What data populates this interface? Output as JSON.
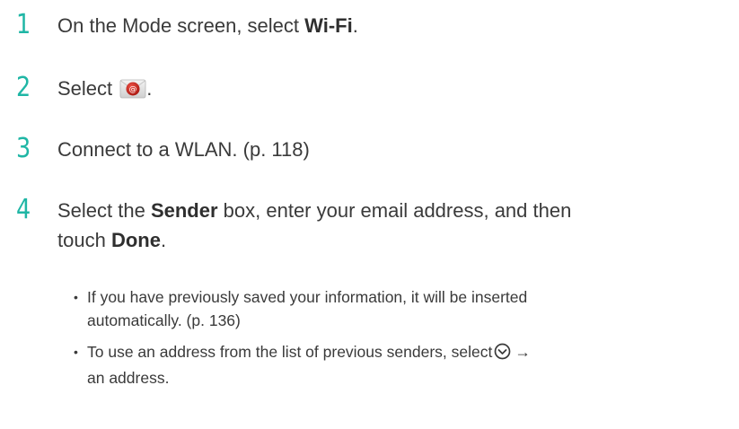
{
  "steps": [
    {
      "num": "1",
      "pre": "On the Mode screen, select ",
      "bold": "Wi-Fi",
      "post": "."
    },
    {
      "num": "2",
      "pre": "Select ",
      "icon": "email-app-icon",
      "post": "."
    },
    {
      "num": "3",
      "text": "Connect to a WLAN. (p. 118)"
    },
    {
      "num": "4",
      "pre": "Select the ",
      "bold1": "Sender",
      "mid": " box, enter your email address, and then",
      "line2_pre": "touch ",
      "bold2": "Done",
      "post": "."
    }
  ],
  "bullets": [
    {
      "line1": "If you have previously saved your information, it will be inserted",
      "line2": "automatically. (p. 136)"
    },
    {
      "line1_pre": "To use an address from the list of previous senders, select",
      "icon": "chevron-down-circle-icon",
      "arrow": "→",
      "line2": "an address."
    }
  ],
  "colors": {
    "step_number": "#1fb6a5",
    "text": "#3a3a3a"
  }
}
